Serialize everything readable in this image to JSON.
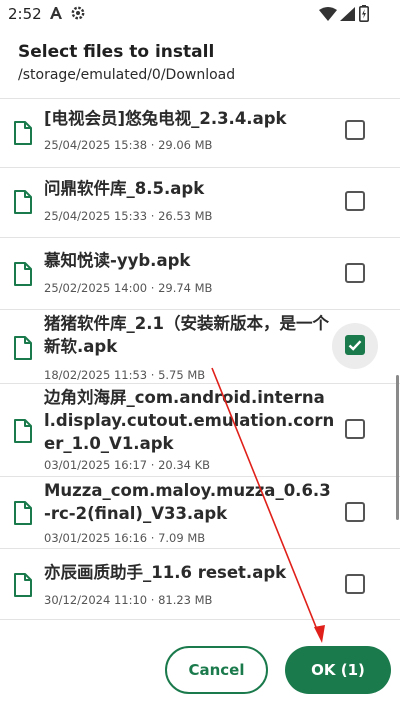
{
  "status_bar": {
    "time": "2:52",
    "icons": [
      "font-a-icon",
      "settings-gear-icon",
      "wifi-icon",
      "signal-icon",
      "battery-charging-icon"
    ]
  },
  "header": {
    "title": "Select files to install",
    "path": "/storage/emulated/0/Download"
  },
  "files": [
    {
      "name": "[电视会员]悠兔电视_2.3.4.apk",
      "date": "25/04/2025 15:38",
      "size": "29.06 MB",
      "checked": false,
      "icon": "file-icon"
    },
    {
      "name": "问鼎软件库_8.5.apk",
      "date": "25/04/2025 15:33",
      "size": "26.53 MB",
      "checked": false,
      "icon": "file-icon"
    },
    {
      "name": "慕知悦读-yyb.apk",
      "date": "25/02/2025 14:00",
      "size": "29.74 MB",
      "checked": false,
      "icon": "file-icon"
    },
    {
      "name": "猪猪软件库_2.1（安装新版本，是一个新软.apk",
      "date": "18/02/2025 11:53",
      "size": "5.75 MB",
      "checked": true,
      "icon": "file-icon"
    },
    {
      "name": "边角刘海屏_com.android.internal.display.cutout.emulation.corner_1.0_V1.apk",
      "date": "03/01/2025 16:17",
      "size": "20.34 KB",
      "checked": false,
      "icon": "file-icon"
    },
    {
      "name": "Muzza_com.maloy.muzza_0.6.3-rc-2(final)_V33.apk",
      "date": "03/01/2025 16:16",
      "size": "7.09 MB",
      "checked": false,
      "icon": "file-icon"
    },
    {
      "name": "亦辰画质助手_11.6 reset.apk",
      "date": "30/12/2024 11:10",
      "size": "81.23 MB",
      "checked": false,
      "icon": "file-icon"
    }
  ],
  "meta_separator": " · ",
  "buttons": {
    "cancel": "Cancel",
    "ok": "OK (1)"
  },
  "colors": {
    "accent": "#1b7a4c",
    "annotation_arrow": "#e0201a"
  }
}
